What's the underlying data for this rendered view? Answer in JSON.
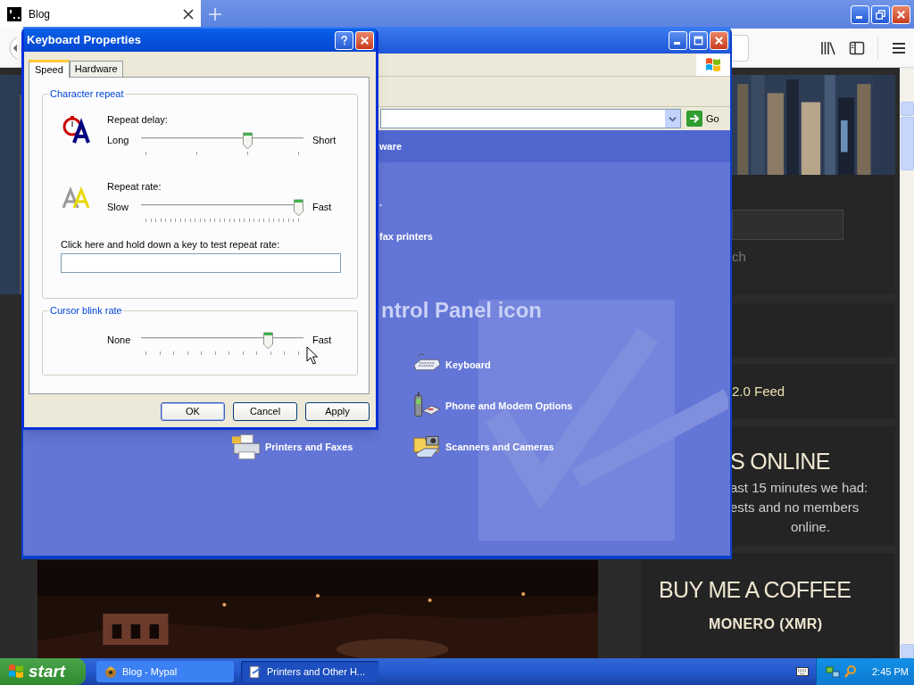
{
  "browser": {
    "tabs": [
      {
        "label": "Blog",
        "selected": true
      }
    ]
  },
  "blog": {
    "search_button": "ch",
    "feed_link": "2.0 Feed",
    "online_title": "S ONLINE",
    "online_lines": [
      "ast 15 minutes we had:",
      "ests and no members",
      "online."
    ],
    "coffee_title": "BUY ME A COFFEE",
    "coffee_subtitle": "MONERO (XMR)"
  },
  "control_panel": {
    "go_button": "Go",
    "header": "ware",
    "task_items": [
      ".",
      "fax printers"
    ],
    "heading": "ntrol Panel icon",
    "items": [
      {
        "label": "Keyboard",
        "kind": "keyboard"
      },
      {
        "label": "Phone and Modem Options",
        "kind": "phone"
      },
      {
        "label": "Printers and Faxes",
        "kind": "printer"
      },
      {
        "label": "Scanners and Cameras",
        "kind": "scanner"
      }
    ]
  },
  "dialog": {
    "title": "Keyboard Properties",
    "tabs": [
      {
        "label": "Speed",
        "selected": true
      },
      {
        "label": "Hardware",
        "selected": false
      }
    ],
    "groups": [
      {
        "title": "Character repeat",
        "sliders": [
          {
            "kind": "delay",
            "label": "Repeat delay:",
            "min": "Long",
            "max": "Short",
            "level": 0.667
          },
          {
            "kind": "rate",
            "label": "Repeat rate:",
            "min": "Slow",
            "max": "Fast",
            "level": 1
          }
        ],
        "test_label": "Click here and hold down a key to test repeat rate:"
      },
      {
        "title": "Cursor blink rate",
        "sliders": [
          {
            "kind": "blink",
            "min": "None",
            "max": "Fast",
            "level": 0.8
          }
        ]
      }
    ],
    "buttons": [
      {
        "label": "OK",
        "default": true
      },
      {
        "label": "Cancel",
        "default": false
      },
      {
        "label": "Apply",
        "default": false
      }
    ]
  },
  "taskbar": {
    "start": "start",
    "items": [
      {
        "label": "Blog - Mypal",
        "kind": "browser",
        "selected": false
      },
      {
        "label": "Printers and Other H...",
        "kind": "folder",
        "selected": true
      }
    ],
    "clock": "2:45 PM"
  }
}
